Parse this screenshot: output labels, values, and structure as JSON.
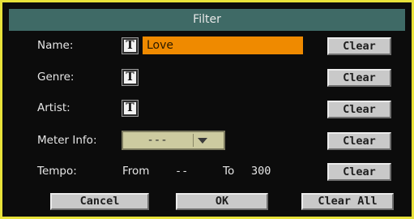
{
  "dialog": {
    "title": "Filter"
  },
  "fields": {
    "name": {
      "label": "Name:",
      "text_icon": "T",
      "value": "Love",
      "clear_label": "Clear"
    },
    "genre": {
      "label": "Genre:",
      "text_icon": "T",
      "value": "",
      "clear_label": "Clear"
    },
    "artist": {
      "label": "Artist:",
      "text_icon": "T",
      "value": "",
      "clear_label": "Clear"
    },
    "meter": {
      "label": "Meter Info:",
      "selected": "---",
      "clear_label": "Clear"
    },
    "tempo": {
      "label": "Tempo:",
      "from_label": "From",
      "from_value": "--",
      "to_label": "To",
      "to_value": "300",
      "clear_label": "Clear"
    }
  },
  "buttons": {
    "cancel": "Cancel",
    "ok": "OK",
    "clear_all": "Clear All"
  },
  "colors": {
    "border": "#e8e23a",
    "title_bar": "#3f6a66",
    "name_field": "#ef8a00",
    "dropdown": "#cdcba0",
    "button": "#c9c9c9"
  }
}
